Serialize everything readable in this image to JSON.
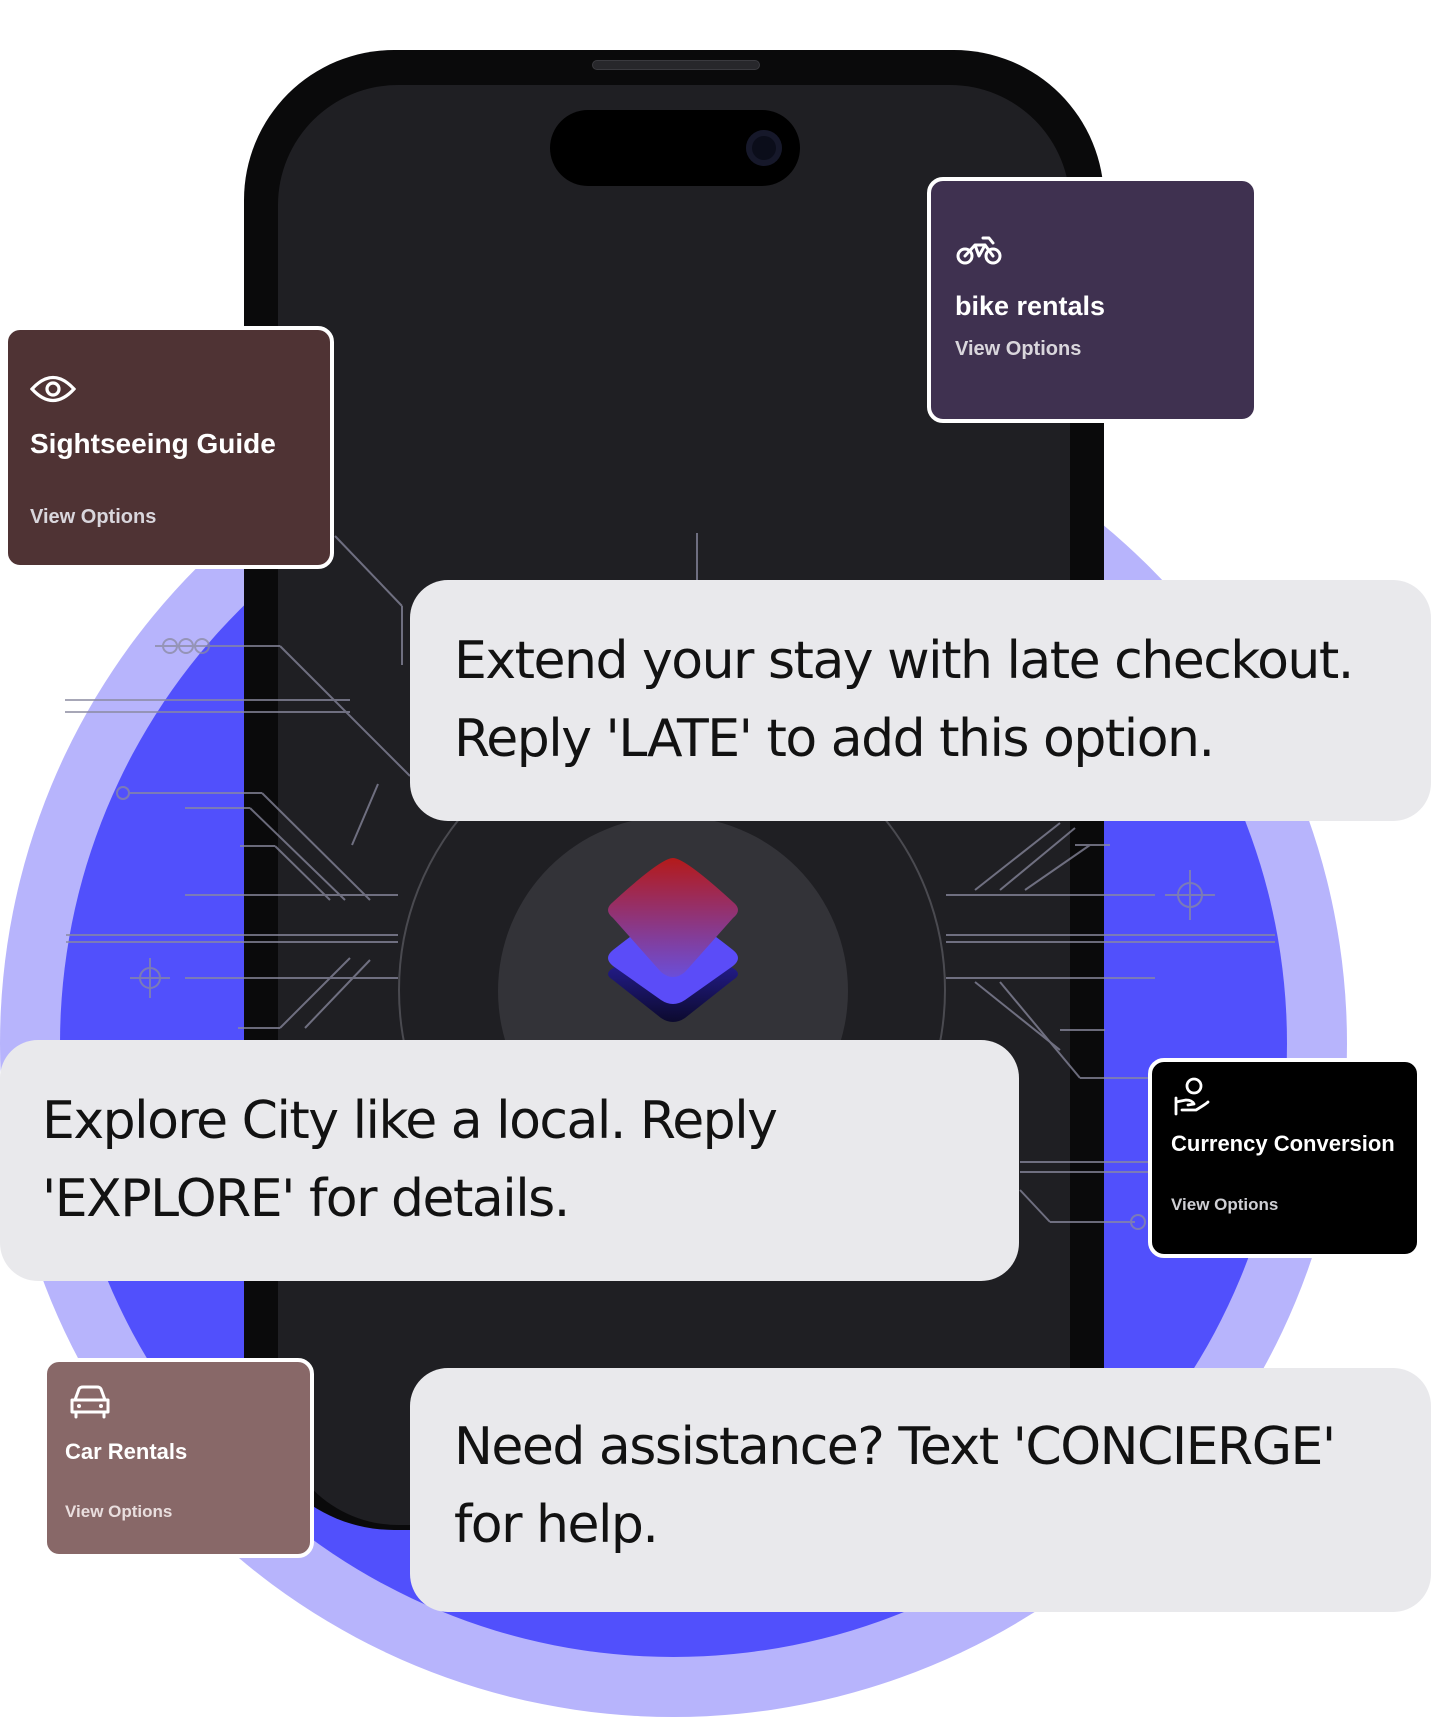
{
  "colors": {
    "ring": "#b7b4fc",
    "disc": "#5150fc",
    "phone_screen": "#1f1f23",
    "bubble_bg": "#e9e9ec",
    "card_sightseeing": "#4f3334",
    "card_bike": "#3f3150",
    "card_currency": "#000000",
    "card_car": "#886868"
  },
  "cards": {
    "sightseeing": {
      "icon": "eye-icon",
      "title": "Sightseeing Guide",
      "action": "View Options"
    },
    "bike": {
      "icon": "bike-icon",
      "title": "bike rentals",
      "action": "View Options"
    },
    "currency": {
      "icon": "hand-coin-icon",
      "title": "Currency Conversion",
      "action": "View Options"
    },
    "car": {
      "icon": "car-icon",
      "title": "Car Rentals",
      "action": "View Options"
    }
  },
  "messages": {
    "late": "Extend your stay with late checkout. Reply 'LATE' to add this option.",
    "explore": "Explore City like a local. Reply 'EXPLORE' for details.",
    "concierge": "Need assistance? Text 'CONCIERGE' for help."
  }
}
